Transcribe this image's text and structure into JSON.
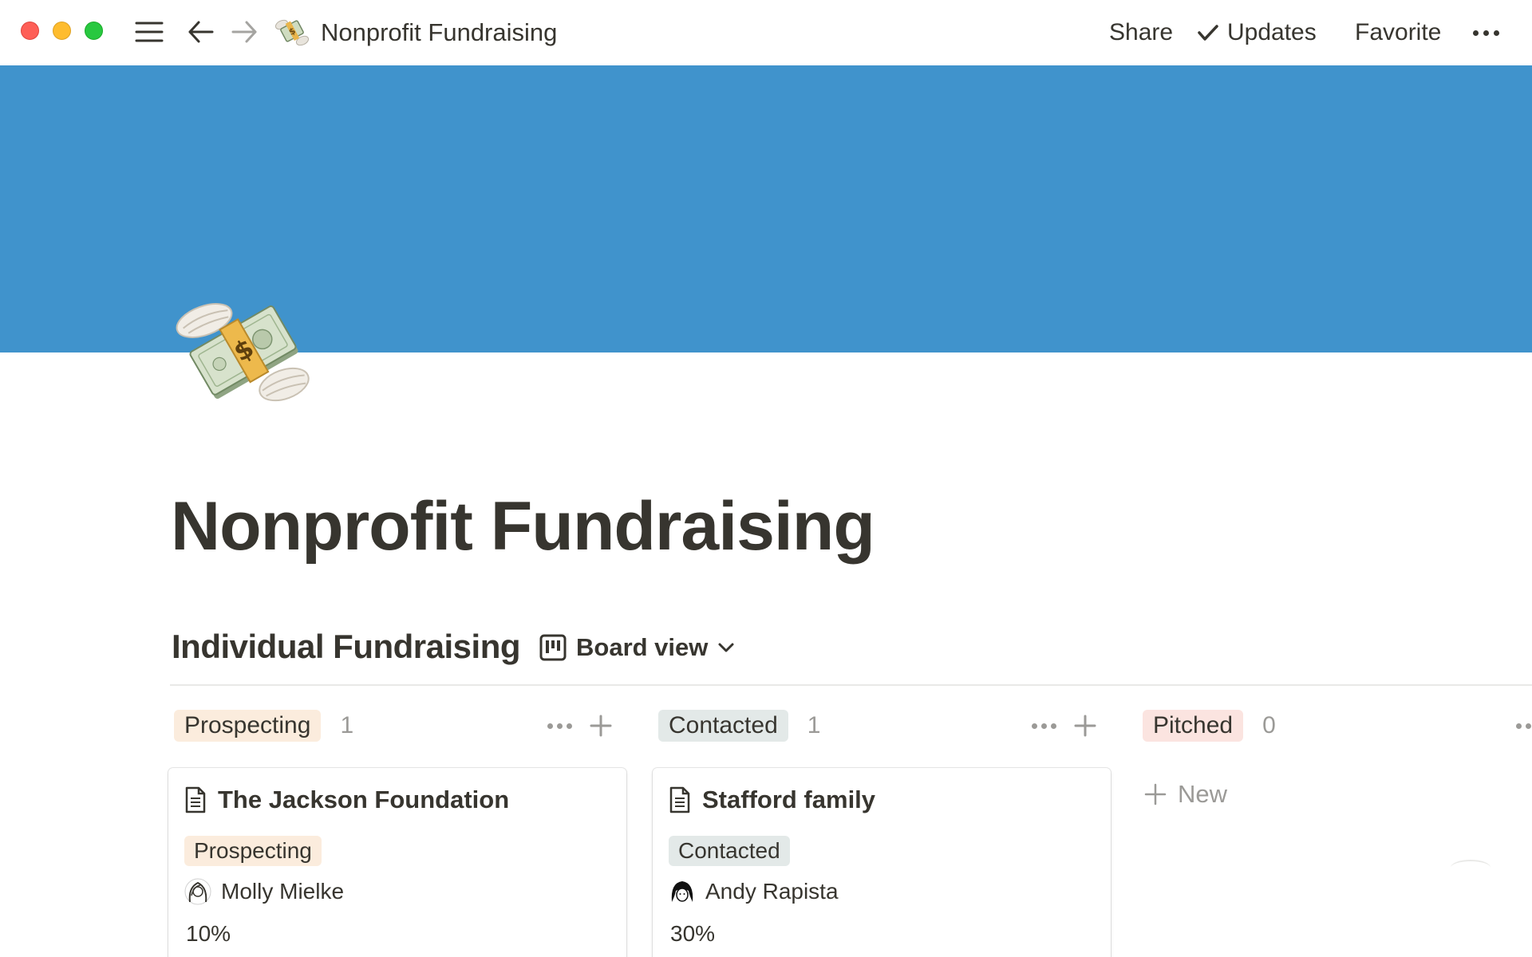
{
  "window": {
    "breadcrumb_title": "Nonprofit Fundraising",
    "breadcrumb_emoji": "money-with-wings-icon",
    "actions": {
      "share": "Share",
      "updates": "Updates",
      "favorite": "Favorite"
    }
  },
  "cover": {
    "color": "#4093cc"
  },
  "page": {
    "title": "Nonprofit Fundraising",
    "icon": "money-with-wings-icon"
  },
  "database": {
    "title": "Individual Fundraising",
    "view_label": "Board view",
    "view_icon": "board-icon",
    "columns": [
      {
        "label": "Prospecting",
        "count": "1",
        "color": "#fbecdd",
        "cards": [
          {
            "title": "The Jackson Foundation",
            "status": "Prospecting",
            "person": "Molly Mielke",
            "percent": "10%"
          }
        ]
      },
      {
        "label": "Contacted",
        "count": "1",
        "color": "#e3e9e8",
        "cards": [
          {
            "title": "Stafford family",
            "status": "Contacted",
            "person": "Andy Rapista",
            "percent": "30%"
          }
        ]
      },
      {
        "label": "Pitched",
        "count": "0",
        "color": "#fbe4e0",
        "new_label": "New",
        "cards": []
      }
    ]
  }
}
